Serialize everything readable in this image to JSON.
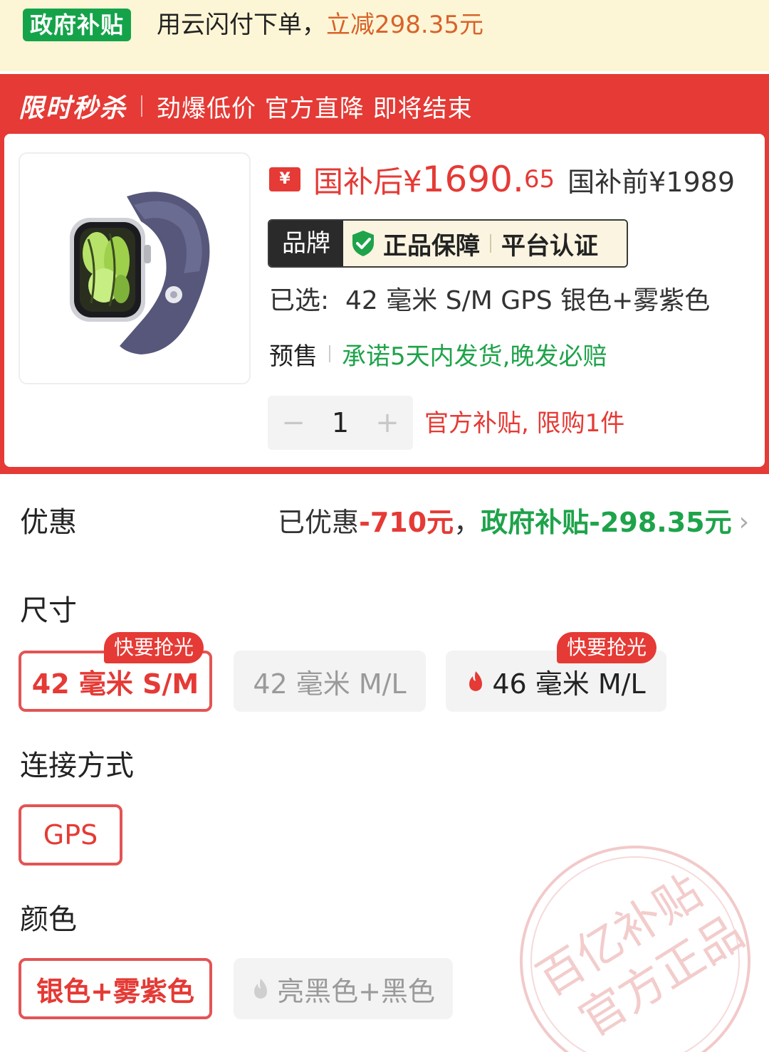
{
  "subsidy_bar": {
    "badge": "政府补贴",
    "text": "用云闪付下单，",
    "amount": "立减298.35元"
  },
  "flash_sale": {
    "title": "限时秒杀",
    "slogan": "劲爆低价 官方直降 即将结束"
  },
  "product": {
    "yen_icon": "¥",
    "price_after_label": "国补后¥",
    "price_after_main": "1690.",
    "price_after_decimal": "65",
    "price_before": "国补前¥1989",
    "guarantee": {
      "brand": "品牌",
      "authentic": "正品保障",
      "certified": "平台认证"
    },
    "selected": "已选:  42 毫米 S/M GPS 银色+雾紫色",
    "presale_label": "预售",
    "presale_promise": "承诺5天内发货,晚发必赔",
    "quantity": {
      "minus": "−",
      "value": "1",
      "plus": "+"
    },
    "limit_text": "官方补贴, 限购1件"
  },
  "discount": {
    "label": "优惠",
    "prefix": "已优惠",
    "amount": "-710元",
    "separator": "，",
    "gov_subsidy": "政府补贴-298.35元",
    "chevron": "›"
  },
  "size": {
    "title": "尺寸",
    "options": [
      {
        "label": "42 毫米 S/M",
        "tag": "快要抢光",
        "state": "selected"
      },
      {
        "label": "42 毫米 M/L",
        "tag": "",
        "state": "unavailable"
      },
      {
        "label": "46 毫米 M/L",
        "tag": "快要抢光",
        "state": "available",
        "icon": "flame-icon"
      }
    ]
  },
  "connection": {
    "title": "连接方式",
    "options": [
      {
        "label": "GPS",
        "state": "selected"
      }
    ]
  },
  "color": {
    "title": "颜色",
    "options": [
      {
        "label": "银色+雾紫色",
        "state": "selected"
      },
      {
        "label": "亮黑色+黑色",
        "state": "unavailable",
        "icon": "flame-icon"
      }
    ]
  },
  "watermark": {
    "line1": "百亿补贴",
    "line2": "官方正品"
  },
  "colors": {
    "red": "#e53a35",
    "green": "#1ea34a",
    "subsidy_bg": "#fcf6d6",
    "orange": "#d9622b"
  }
}
